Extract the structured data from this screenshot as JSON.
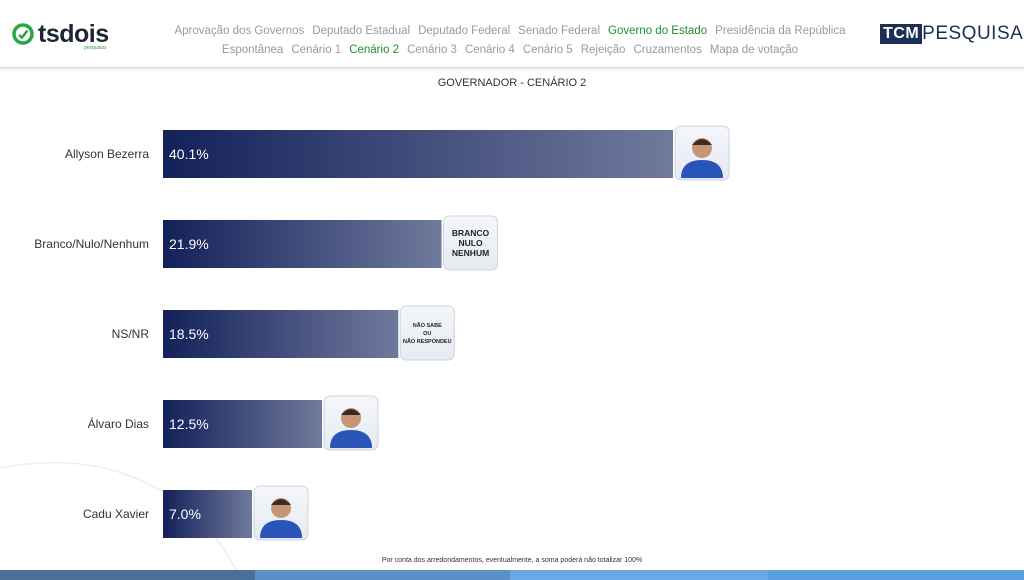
{
  "header": {
    "logo_text": "tsdois",
    "logo_subtext": "pesquisas",
    "brand_box": "TCM",
    "brand_rest": "PESQUISA",
    "nav_row1": [
      {
        "label": "Aprovação dos Governos",
        "active": false
      },
      {
        "label": "Deputado Estadual",
        "active": false
      },
      {
        "label": "Deputado Federal",
        "active": false
      },
      {
        "label": "Senado Federal",
        "active": false
      },
      {
        "label": "Governo do Estado",
        "active": true
      },
      {
        "label": "Presidência da República",
        "active": false
      }
    ],
    "nav_row2": [
      {
        "label": "Espontânea",
        "active": false
      },
      {
        "label": "Cenário 1",
        "active": false
      },
      {
        "label": "Cenário 2",
        "active": true
      },
      {
        "label": "Cenário 3",
        "active": false
      },
      {
        "label": "Cenário 4",
        "active": false
      },
      {
        "label": "Cenário 5",
        "active": false
      },
      {
        "label": "Rejeição",
        "active": false
      },
      {
        "label": "Cruzamentos",
        "active": false
      },
      {
        "label": "Mapa de votação",
        "active": false
      }
    ]
  },
  "chart_data": {
    "type": "bar",
    "orientation": "horizontal",
    "title": "GOVERNADOR - CENÁRIO 2",
    "categories": [
      "Allyson Bezerra",
      "Branco/Nulo/Nenhum",
      "NS/NR",
      "Álvaro Dias",
      "Cadu Xavier"
    ],
    "values": [
      40.1,
      21.9,
      18.5,
      12.5,
      7.0
    ],
    "value_labels": [
      "40.1%",
      "21.9%",
      "18.5%",
      "12.5%",
      "7.0%"
    ],
    "badges": [
      {
        "kind": "photo",
        "icon": "candidate-photo-icon"
      },
      {
        "kind": "text",
        "lines": [
          "BRANCO",
          "NULO",
          "NENHUM"
        ]
      },
      {
        "kind": "text",
        "lines": [
          "NÃO SABE",
          "OU",
          "NÃO RESPONDEU"
        ]
      },
      {
        "kind": "photo",
        "icon": "candidate-photo-icon"
      },
      {
        "kind": "photo",
        "icon": "candidate-photo-icon"
      }
    ],
    "xlim": [
      0,
      40.1
    ],
    "grid": false,
    "legend": "none",
    "colors": {
      "bar_start": "#13215a",
      "bar_end": "#6f7a9c",
      "label": "#ffffff"
    }
  },
  "footnote": "Por conta dos arredondamentos, eventualmente, a soma poderá não totalizar 100%",
  "colors": {
    "accent_green": "#1f8f2f",
    "nav_gray": "#9a9a9a",
    "brand_navy": "#1c2f55",
    "strip": [
      "#4a6f99",
      "#5a8fc8",
      "#6aa9e6",
      "#5aa0e0"
    ]
  }
}
